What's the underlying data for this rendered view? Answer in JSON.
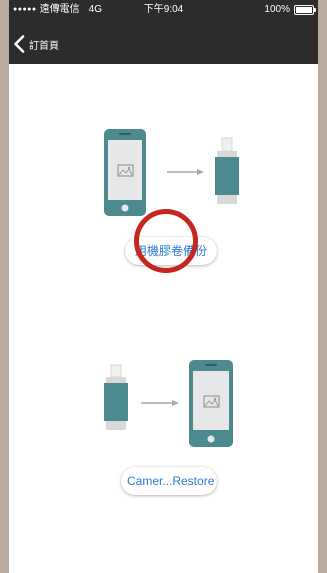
{
  "status_bar": {
    "signal": "●●●●●",
    "carrier": "遠傳電信",
    "network": "4G",
    "time": "下午9:04",
    "battery": "100%"
  },
  "nav": {
    "back_icon": "chevron-left-icon",
    "back_label": "訂首頁"
  },
  "backup": {
    "button_label": "用機膠卷備份"
  },
  "restore": {
    "button_label": "Camer...Restore"
  },
  "colors": {
    "accent_teal": "#4d8a8f",
    "screen_gray": "#e6e7e8",
    "button_text_blue": "#2b7bd6",
    "tap_circle_red": "#c6261d",
    "nav_bg": "#2c2c2c"
  }
}
